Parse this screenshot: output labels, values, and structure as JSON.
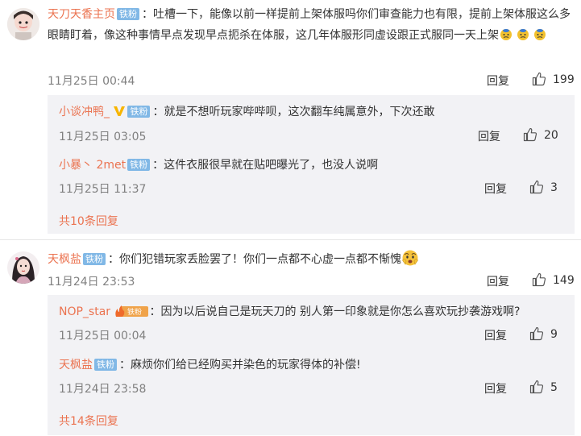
{
  "labels": {
    "reply": "回复"
  },
  "colors": {
    "username": "#eb7350",
    "badge": "#81b8e6",
    "reply_bg": "#f2f2f5"
  },
  "c1": {
    "user": "天刀天香主页",
    "badge": "铁粉",
    "text": "：吐槽一下，能像以前一样提前上架体服吗你们审查能力也有限，提前上架体服这么多眼睛盯着，像这种事情早点发现早点扼杀在体服，这几年体服形同虚设跟正式服同一天上架",
    "time": "11月25日 00:44",
    "likes": "199",
    "replies": [
      {
        "user": "小谈冲鸭_",
        "badge": "铁粉",
        "text": "：就是不想听玩家哔哔呗，这次翻车纯属意外，下次还敢",
        "time": "11月25日 03:05",
        "likes": "20"
      },
      {
        "user": "小暴丶 2met",
        "badge": "铁粉",
        "text": "：这件衣服很早就在贴吧曝光了，也没人说啊",
        "time": "11月25日 11:37",
        "likes": "3"
      }
    ],
    "more": "共10条回复"
  },
  "c2": {
    "user": "天枫盐",
    "badge": "铁粉",
    "text": "：你们犯错玩家丢脸罢了！你们一点都不心虚一点都不惭愧",
    "time": "11月24日 23:53",
    "likes": "149",
    "replies": [
      {
        "user": "NOP_star",
        "badge": "铁粉",
        "text": "：因为以后说自己是玩天刀的 别人第一印象就是你怎么喜欢玩抄袭游戏啊?",
        "time": "11月25日 00:04",
        "likes": "9"
      },
      {
        "user": "天枫盐",
        "badge": "铁粉",
        "text": "：麻烦你们给已经购买并染色的玩家得体的补偿!",
        "time": "11月24日 23:58",
        "likes": "5"
      }
    ],
    "more": "共14条回复"
  }
}
